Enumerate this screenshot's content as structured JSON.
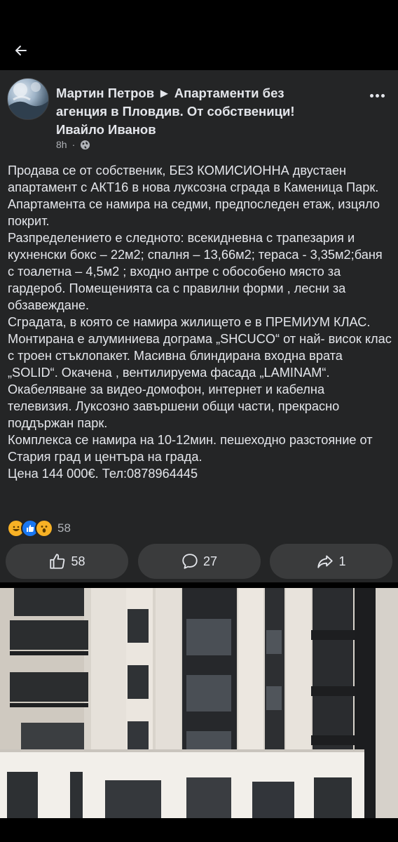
{
  "post": {
    "author": "Мартин Петров",
    "arrow": "►",
    "group_line1": "Апартаменти без",
    "group_line2": "агенция в Пловдив. От собственици!",
    "shared_by": "Ивайло Иванов",
    "time": "8h",
    "separator": "·",
    "privacy_icon": "globe-icon",
    "paragraphs": [
      "Продава се от собственик, БЕЗ КОМИСИОННА двустаен апартамент с АКТ16 в нова луксозна сграда в Каменица Парк. Апартамента се намира на седми, предпоследен етаж, изцяло покрит.",
      "Разпределението е следното: всекидневна с трапезария и кухненски бокс – 22м2; спалня – 13,66м2; тераса - 3,35м2;баня с тоалетна – 4,5м2 ; входно антре с обособено място за гардероб. Помещенията са с правилни форми , лесни за обзавеждане.",
      "Сградата, в която се намира жилището е в ПРЕМИУМ КЛАС. Монтирана е алуминиева дограма „SHCUCO“ от най- висок клас с троен стъклопакет. Масивна блиндирана входна врата „SOLID“. Окачена , вентилируема фасада „LAMINAM“. Окабеляване  за видео-домофон, интернет и кабелна телевизия. Луксозно завършени общи части, прекрасно поддържан парк.",
      "Комплекса се намира на 10-12мин. пешеходно разстояние от Стария град и центъра на града.",
      "Цена 144 000€. Тел:0878964445"
    ],
    "reaction_total": "58",
    "reaction_icons": [
      "haha-icon",
      "like-icon",
      "wow-icon"
    ]
  },
  "actions": {
    "like_count": "58",
    "comment_count": "27",
    "share_count": "1"
  },
  "colors": {
    "background": "#000000",
    "card": "#242526",
    "pill": "#3a3b3c",
    "text": "#e4e6eb",
    "secondary_text": "#b0b3b8",
    "like_blue": "#1877f2",
    "emoji_yellow": "#f7b125"
  }
}
